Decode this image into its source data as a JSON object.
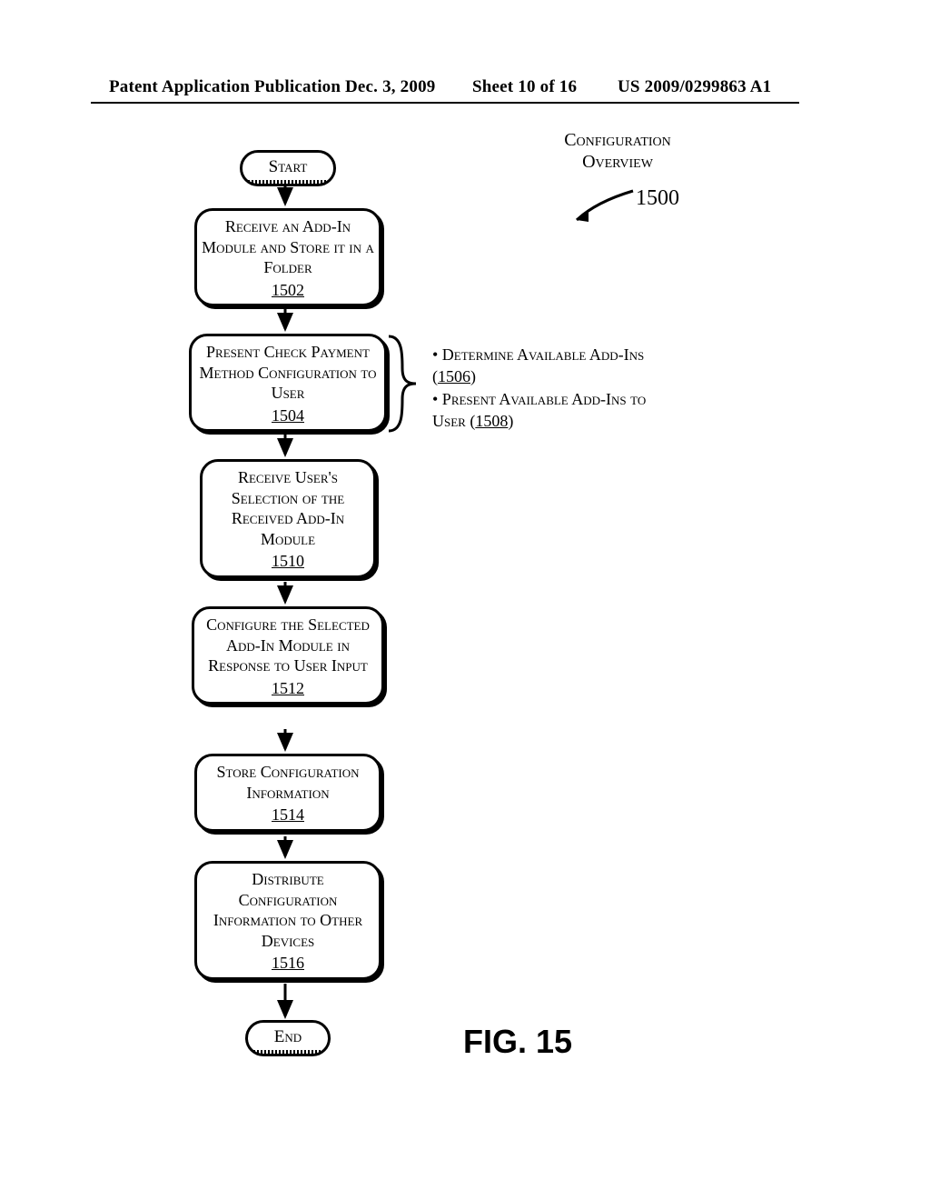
{
  "header": {
    "publication": "Patent Application Publication",
    "date": "Dec. 3, 2009",
    "sheet": "Sheet 10 of 16",
    "doc_number": "US 2009/0299863 A1"
  },
  "overview": {
    "line1": "Configuration",
    "line2": "Overview"
  },
  "figure_ref": "1500",
  "flow": {
    "start": "Start",
    "end": "End",
    "step_1502": {
      "text": "Receive an Add-In Module and Store it in a Folder",
      "ref": "1502"
    },
    "step_1504": {
      "text": "Present Check Payment Method Configuration to User",
      "ref": "1504"
    },
    "step_1510": {
      "text": "Receive User's Selection of the Received Add-In Module",
      "ref": "1510"
    },
    "step_1512": {
      "text": "Configure the Selected Add-In Module in Response to User Input",
      "ref": "1512"
    },
    "step_1514": {
      "text": "Store Configuration Information",
      "ref": "1514"
    },
    "step_1516": {
      "text": "Distribute Configuration Information to Other Devices",
      "ref": "1516"
    }
  },
  "side_notes": {
    "bullet1_prefix": "• Determine Available Add-Ins (",
    "bullet1_ref": "1506",
    "bullet1_suffix": ")",
    "bullet2_prefix": "• Present Available Add-Ins to User (",
    "bullet2_ref": "1508",
    "bullet2_suffix": ")"
  },
  "figure_label": "FIG. 15"
}
